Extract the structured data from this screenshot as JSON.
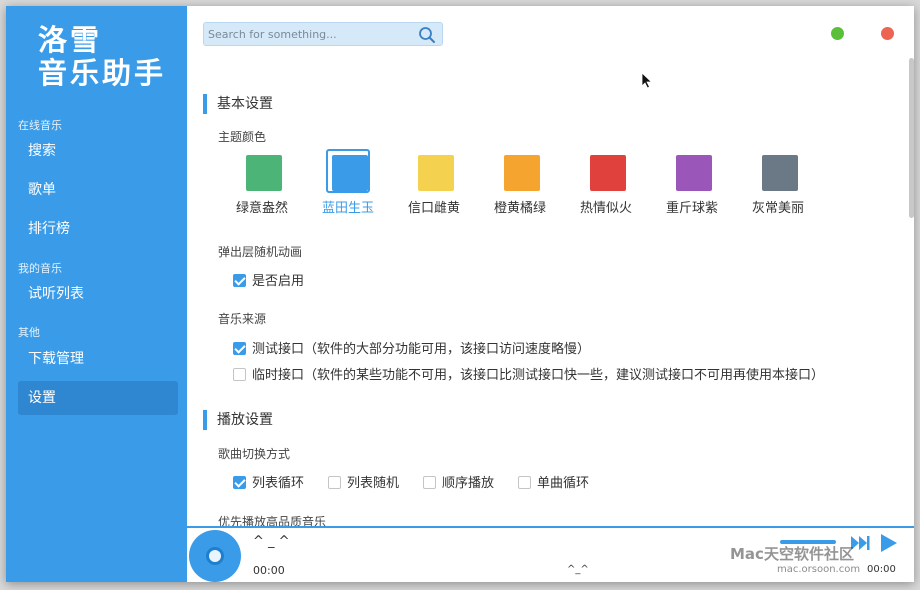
{
  "app": {
    "logo_line1": "洛雪",
    "logo_line2": "音乐助手"
  },
  "sidebar": {
    "groups": [
      {
        "title": "在线音乐",
        "items": [
          {
            "label": "搜索"
          },
          {
            "label": "歌单"
          },
          {
            "label": "排行榜"
          }
        ]
      },
      {
        "title": "我的音乐",
        "items": [
          {
            "label": "试听列表"
          }
        ]
      },
      {
        "title": "其他",
        "items": [
          {
            "label": "下载管理"
          },
          {
            "label": "设置"
          }
        ]
      }
    ],
    "active": "设置"
  },
  "search": {
    "placeholder": "Search for something...",
    "value": "",
    "icon": "search-icon"
  },
  "window_controls": {
    "minimize_color": "#5cbf3a",
    "close_color": "#ec6553"
  },
  "settings": {
    "basic": {
      "title": "基本设置",
      "theme_label": "主题颜色",
      "themes": [
        {
          "name": "绿意盎然",
          "color": "#4db478"
        },
        {
          "name": "蓝田生玉",
          "color": "#3a9be8"
        },
        {
          "name": "信口雌黄",
          "color": "#f5d150"
        },
        {
          "name": "橙黄橘绿",
          "color": "#f6a430"
        },
        {
          "name": "热情似火",
          "color": "#e0413d"
        },
        {
          "name": "重斤球紫",
          "color": "#9a56b8"
        },
        {
          "name": "灰常美丽",
          "color": "#6b7886"
        }
      ],
      "selected_theme": "蓝田生玉",
      "popup_label": "弹出层随机动画",
      "popup_option": {
        "label": "是否启用",
        "checked": true
      },
      "source_label": "音乐来源",
      "sources": [
        {
          "label": "测试接口（软件的大部分功能可用，该接口访问速度略慢）",
          "checked": true
        },
        {
          "label": "临时接口（软件的某些功能不可用，该接口比测试接口快一些，建议测试接口不可用再使用本接口）",
          "checked": false
        }
      ]
    },
    "playback": {
      "title": "播放设置",
      "switch_label": "歌曲切换方式",
      "modes": [
        {
          "label": "列表循环",
          "checked": true
        },
        {
          "label": "列表随机",
          "checked": false
        },
        {
          "label": "顺序播放",
          "checked": false
        },
        {
          "label": "单曲循环",
          "checked": false
        }
      ],
      "quality_label": "优先播放高品质音乐"
    }
  },
  "player": {
    "track": "^ _ ^",
    "time_current": "00:00",
    "center_text": "^_^",
    "time_total": "00:00",
    "accent": "#3a9be8"
  },
  "watermark": {
    "line1": "Mac天空软件社区",
    "line2": "mac.orsoon.com"
  }
}
